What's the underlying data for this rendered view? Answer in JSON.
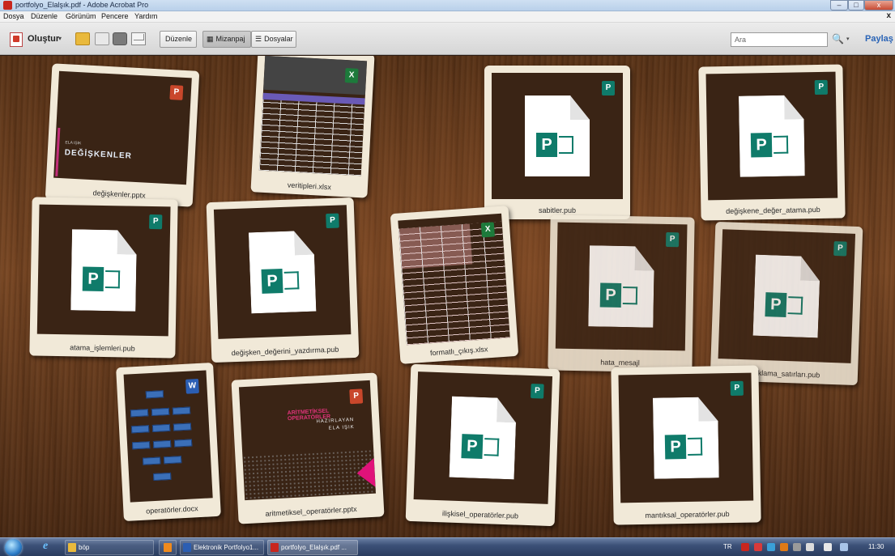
{
  "window": {
    "title": "portfolyo_Elalşık.pdf - Adobe Acrobat Pro",
    "min": "–",
    "max": "□",
    "close": "x"
  },
  "menu": {
    "items": [
      "Dosya",
      "Düzenle",
      "Görünüm",
      "Pencere",
      "Yardım"
    ],
    "close": "x"
  },
  "toolbar": {
    "create_label": "Oluştur",
    "create_arrow": "▾",
    "edit_label": "Düzenle",
    "layout_label": "Mizanpaj",
    "files_label": "Dosyalar",
    "search_placeholder": "Ara",
    "binoc": "🔍",
    "binoc_arrow": "▾",
    "share_label": "Paylaş"
  },
  "cards": {
    "c1": {
      "label": "değişkenler.pptx",
      "small": "ELA IŞIK",
      "big": "DEĞİŞKENLER",
      "badge": "P"
    },
    "c2": {
      "label": "veritipleri.xlsx",
      "badge": "X"
    },
    "c3": {
      "label": "sabitler.pub",
      "badge": "P"
    },
    "c4": {
      "label": "değişkene_değer_atama.pub",
      "badge": "P"
    },
    "c5": {
      "label": "atama_işlemleri.pub",
      "badge": "P"
    },
    "c6": {
      "label": "değişken_değerini_yazdırma.pub",
      "badge": "P"
    },
    "c7": {
      "label": "formatlı_çıkış.xlsx",
      "badge": "X"
    },
    "c8": {
      "label": "hata_mesajl",
      "badge": "P"
    },
    "c9": {
      "label": "açıklama_satırları.pub",
      "badge": "P"
    },
    "c10": {
      "label": "operatörler.docx",
      "badge": "W"
    },
    "c11": {
      "label": "aritmetiksel_operatörler.pptx",
      "t1": "ARİTMETİKSEL OPERATÖRLER",
      "t2": "HAZIRLAYAN",
      "t3": "ELA IŞIK",
      "badge": "P"
    },
    "c12": {
      "label": "ilişkisel_operatörler.pub",
      "badge": "P"
    },
    "c13": {
      "label": "mantıksal_operatörler.pub",
      "badge": "P"
    }
  },
  "pub_logo": "P",
  "taskbar": {
    "bop": "böp",
    "word": "Elektronik Portfolyo1...",
    "acrobat": "portfolyo_Elalşık.pdf ...",
    "lang": "TR",
    "time": "11:30"
  }
}
